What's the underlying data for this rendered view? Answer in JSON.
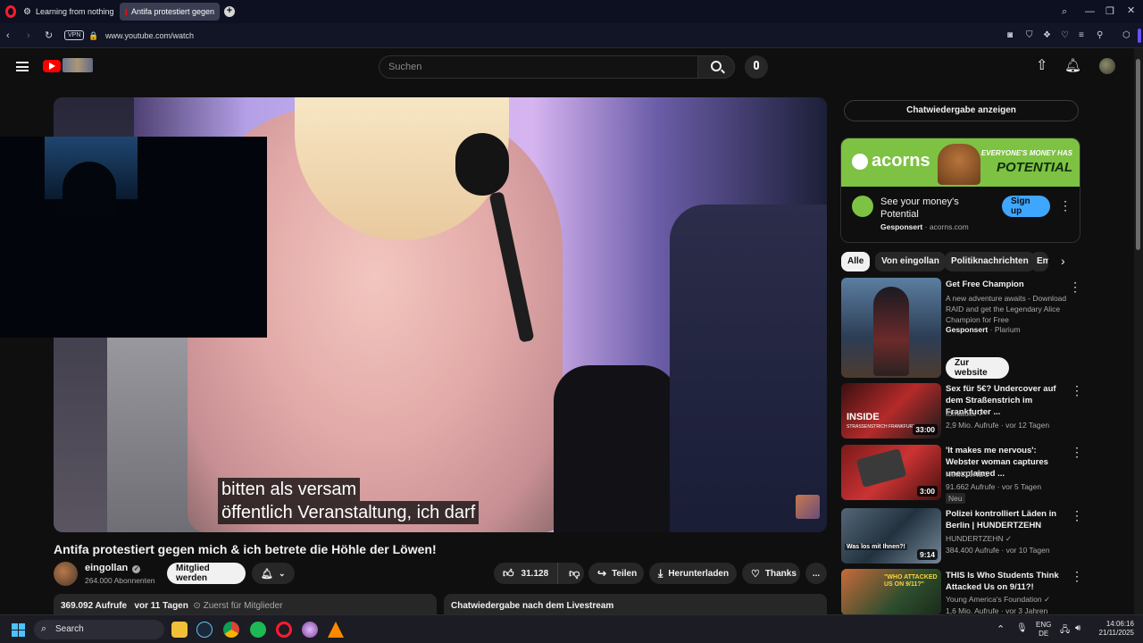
{
  "browser": {
    "tabs": [
      {
        "label": "Learning from nothing",
        "icon": "gear-icon"
      },
      {
        "label": "Antifa protestiert gegen",
        "icon": "youtube-icon"
      }
    ],
    "vpn_label": "VPN",
    "url": "www.youtube.com/watch"
  },
  "youtube": {
    "search_placeholder": "Suchen",
    "video": {
      "caption_line1": "bitten als versam",
      "caption_line2": "öffentlich Veranstaltung, ich darf",
      "title": "Antifa protestiert gegen mich & ich betrete die Höhle der Löwen!"
    },
    "channel": {
      "name": "eingollan",
      "subscribers": "264.000 Abonnenten",
      "member_button": "Mitglied werden"
    },
    "actions": {
      "likes": "31.128",
      "share": "Teilen",
      "download": "Herunterladen",
      "thanks": "Thanks",
      "more": "..."
    },
    "description_card": {
      "views": "369.092 Aufrufe",
      "age": "vor 11 Tagen",
      "members_first": "Zuerst für Mitglieder"
    },
    "chat_card_label": "Chatwiedergabe nach dem Livestream"
  },
  "sidebar": {
    "chat_replay": "Chatwiedergabe anzeigen",
    "ad": {
      "brand": "acorns",
      "banner_text_small": "EVERYONE'S MONEY HAS",
      "banner_text_big": "POTENTIAL",
      "title": "See your money's Potential",
      "sponsored": "Gesponsert",
      "domain": "acorns.com",
      "cta": "Sign up"
    },
    "chips": [
      "Alle",
      "Von eingollan",
      "Politiknachrichten",
      "Em"
    ],
    "recommendations": [
      {
        "title": "Get Free Champion",
        "description": "A new adventure awaits - Download RAID and get the Legendary Alice Champion for Free",
        "sponsored": "Gesponsert",
        "advertiser": "Plarium",
        "cta": "Zur website"
      },
      {
        "title": "Sex für 5€? Undercover auf dem Straßenstrich im Frankfurter ...",
        "channel": "tomatolix",
        "meta": "2,9 Mio. Aufrufe · vor 12 Tagen",
        "duration": "33:00",
        "thumb_text": "INSIDE",
        "thumb_subtext": "STRASSENSTRICH FRANKFURT"
      },
      {
        "title": "'It makes me nervous': Webster woman captures unexplained ...",
        "channel": "News10NBC",
        "meta": "91.662 Aufrufe · vor 5 Tagen",
        "badge": "Neu",
        "duration": "3:00"
      },
      {
        "title": "Polizei kontrolliert Läden in Berlin | HUNDERTZEHN",
        "channel": "HUNDERTZEHN",
        "meta": "384.400 Aufrufe · vor 10 Tagen",
        "duration": "9:14",
        "thumb_text": "Was los mit Ihnen?!"
      },
      {
        "title": "THIS Is Who Students Think Attacked Us on 9/11?!",
        "channel": "Young America's Foundation",
        "meta": "1,6 Mio. Aufrufe · vor 3 Jahren",
        "thumb_text": "\"WHO ATTACKED US ON 9/11?\""
      }
    ]
  },
  "taskbar": {
    "search_label": "Search",
    "lang_top": "ENG",
    "lang_bottom": "DE",
    "time": "14:06:16",
    "date": "21/11/2025"
  }
}
